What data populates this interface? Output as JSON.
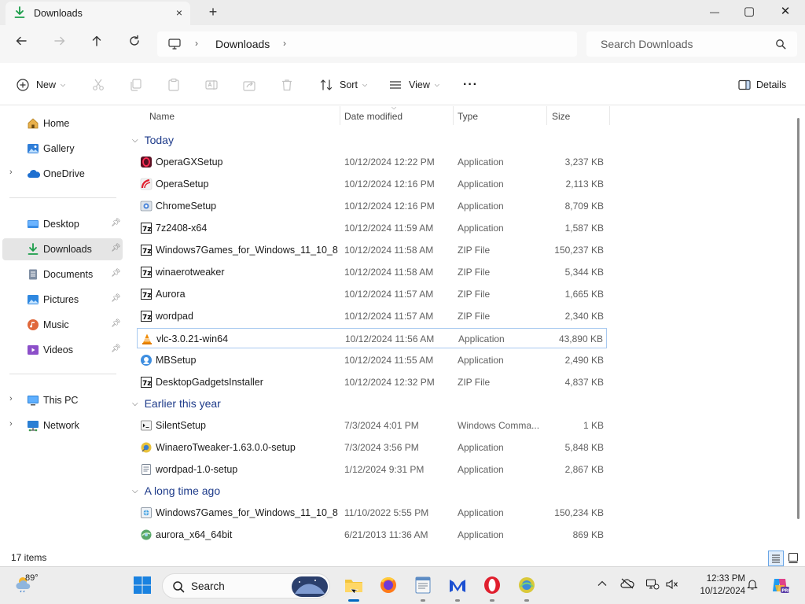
{
  "window": {
    "tab_title": "Downloads",
    "tab_close": "×",
    "new_tab": "+",
    "minimize": "—",
    "maximize": "▢",
    "close": "✕"
  },
  "address": {
    "crumb": "Downloads",
    "search_placeholder": "Search Downloads"
  },
  "toolbar": {
    "new_label": "New",
    "sort_label": "Sort",
    "view_label": "View",
    "more_label": "···",
    "details_label": "Details"
  },
  "sidebar": {
    "items": [
      {
        "label": "Home",
        "icon": "home-icon"
      },
      {
        "label": "Gallery",
        "icon": "gallery-icon"
      },
      {
        "label": "OneDrive",
        "icon": "onedrive-icon"
      },
      {
        "label": "Desktop",
        "icon": "desktop-icon"
      },
      {
        "label": "Downloads",
        "icon": "downloads-icon"
      },
      {
        "label": "Documents",
        "icon": "documents-icon"
      },
      {
        "label": "Pictures",
        "icon": "pictures-icon"
      },
      {
        "label": "Music",
        "icon": "music-icon"
      },
      {
        "label": "Videos",
        "icon": "videos-icon"
      },
      {
        "label": "This PC",
        "icon": "this-pc-icon"
      },
      {
        "label": "Network",
        "icon": "network-icon"
      }
    ]
  },
  "columns": {
    "name": "Name",
    "date": "Date modified",
    "type": "Type",
    "size": "Size"
  },
  "groups": [
    {
      "label": "Today",
      "files": [
        {
          "name": "OperaGXSetup",
          "date": "10/12/2024 12:22 PM",
          "type": "Application",
          "size": "3,237 KB",
          "icon": "operagx-icon"
        },
        {
          "name": "OperaSetup",
          "date": "10/12/2024 12:16 PM",
          "type": "Application",
          "size": "2,113 KB",
          "icon": "opera-icon"
        },
        {
          "name": "ChromeSetup",
          "date": "10/12/2024 12:16 PM",
          "type": "Application",
          "size": "8,709 KB",
          "icon": "chrome-setup-icon"
        },
        {
          "name": "7z2408-x64",
          "date": "10/12/2024 11:59 AM",
          "type": "Application",
          "size": "1,587 KB",
          "icon": "7zip-icon"
        },
        {
          "name": "Windows7Games_for_Windows_11_10_8",
          "date": "10/12/2024 11:58 AM",
          "type": "ZIP File",
          "size": "150,237 KB",
          "icon": "7zip-icon"
        },
        {
          "name": "winaerotweaker",
          "date": "10/12/2024 11:58 AM",
          "type": "ZIP File",
          "size": "5,344 KB",
          "icon": "7zip-icon"
        },
        {
          "name": "Aurora",
          "date": "10/12/2024 11:57 AM",
          "type": "ZIP File",
          "size": "1,665 KB",
          "icon": "7zip-icon"
        },
        {
          "name": "wordpad",
          "date": "10/12/2024 11:57 AM",
          "type": "ZIP File",
          "size": "2,340 KB",
          "icon": "7zip-icon"
        },
        {
          "name": "vlc-3.0.21-win64",
          "date": "10/12/2024 11:56 AM",
          "type": "Application",
          "size": "43,890 KB",
          "icon": "vlc-icon"
        },
        {
          "name": "MBSetup",
          "date": "10/12/2024 11:55 AM",
          "type": "Application",
          "size": "2,490 KB",
          "icon": "malwarebytes-icon"
        },
        {
          "name": "DesktopGadgetsInstaller",
          "date": "10/12/2024 12:32 PM",
          "type": "ZIP File",
          "size": "4,837 KB",
          "icon": "7zip-icon"
        }
      ]
    },
    {
      "label": "Earlier this year",
      "files": [
        {
          "name": "SilentSetup",
          "date": "7/3/2024 4:01 PM",
          "type": "Windows Comma...",
          "size": "1 KB",
          "icon": "script-icon"
        },
        {
          "name": "WinaeroTweaker-1.63.0.0-setup",
          "date": "7/3/2024 3:56 PM",
          "type": "Application",
          "size": "5,848 KB",
          "icon": "installer-icon"
        },
        {
          "name": "wordpad-1.0-setup",
          "date": "1/12/2024 9:31 PM",
          "type": "Application",
          "size": "2,867 KB",
          "icon": "setup-icon"
        }
      ]
    },
    {
      "label": "A long time ago",
      "files": [
        {
          "name": "Windows7Games_for_Windows_11_10_8",
          "date": "11/10/2022 5:55 PM",
          "type": "Application",
          "size": "150,234 KB",
          "icon": "installer-icon"
        },
        {
          "name": "aurora_x64_64bit",
          "date": "6/21/2013 11:36 AM",
          "type": "Application",
          "size": "869 KB",
          "icon": "aurora-icon"
        }
      ]
    }
  ],
  "status": {
    "count": "17 items"
  },
  "taskbar": {
    "temperature": "89°",
    "search_label": "Search",
    "time": "12:33 PM",
    "date": "10/12/2024"
  },
  "colors": {
    "accent": "#0067c0",
    "group_header": "#1e3b8a",
    "selected_nav": "#e5e5e5",
    "focus_border": "#a8c9f0"
  }
}
